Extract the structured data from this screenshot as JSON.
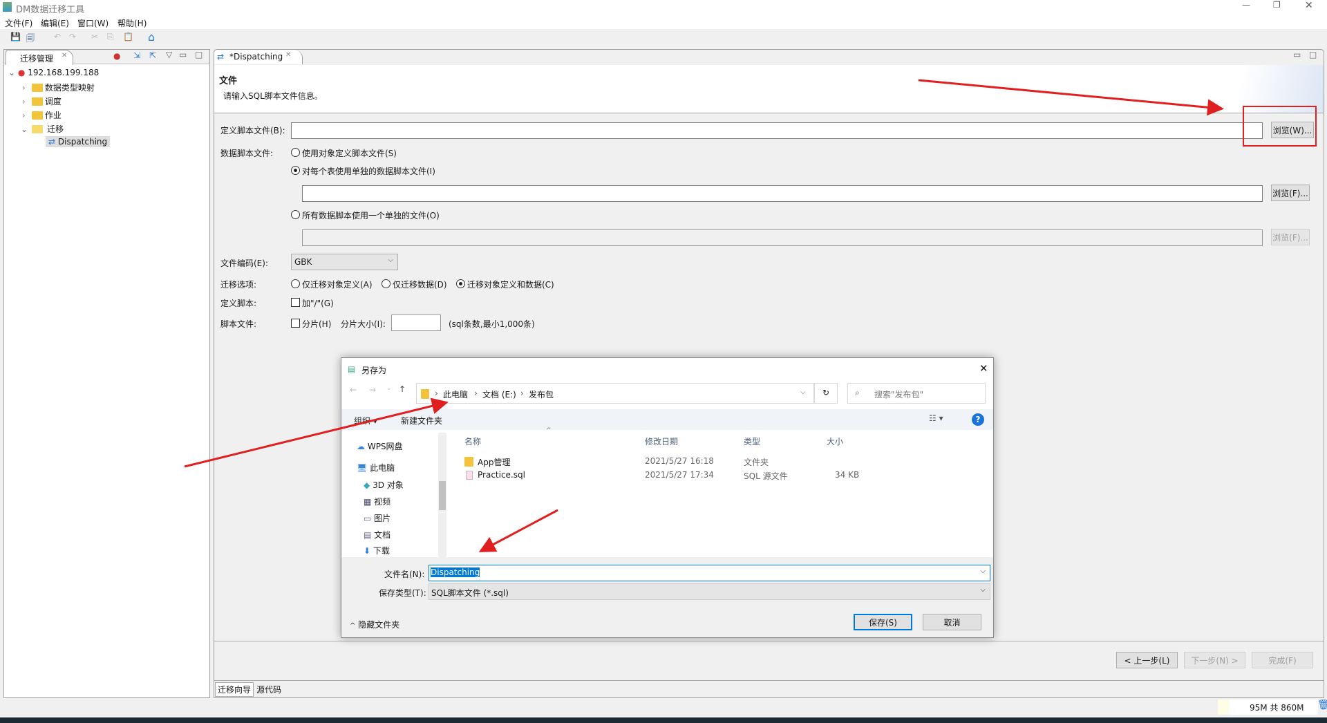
{
  "app": {
    "title": "DM数据迁移工具"
  },
  "menu": [
    "文件(F)",
    "编辑(E)",
    "窗口(W)",
    "帮助(H)"
  ],
  "left_panel": {
    "tab": "迁移管理",
    "tree": [
      {
        "label": "192.168.199.188",
        "level": 0,
        "expanded": true
      },
      {
        "label": "数据类型映射",
        "level": 1
      },
      {
        "label": "调度",
        "level": 1
      },
      {
        "label": "作业",
        "level": 1
      },
      {
        "label": "迁移",
        "level": 1,
        "expanded": true
      },
      {
        "label": "Dispatching",
        "level": 2,
        "selected": true
      }
    ]
  },
  "editor": {
    "tab": "*Dispatching",
    "section_title": "文件",
    "section_desc": "请输入SQL脚本文件信息。",
    "def_script_label": "定义脚本文件(B):",
    "def_script_value": "",
    "browse_w": "浏览(W)...",
    "data_script_label": "数据脚本文件:",
    "radio_use_def": "使用对象定义脚本文件(S)",
    "radio_per_table": "对每个表使用单独的数据脚本文件(I)",
    "radio_single": "所有数据脚本使用一个单独的文件(O)",
    "browse_f": "浏览(F)...",
    "encoding_label": "文件编码(E):",
    "encoding_value": "GBK",
    "options_label": "迁移选项:",
    "opt_def": "仅迁移对象定义(A)",
    "opt_data": "仅迁移数据(D)",
    "opt_both": "迁移对象定义和数据(C)",
    "defscript_label": "定义脚本:",
    "add_slash": "加\"/\"(G)",
    "scriptfile_label": "脚本文件:",
    "split": "分片(H)",
    "split_size_label": "分片大小(I):",
    "split_size_value": "",
    "split_hint": "(sql条数,最小1,000条)",
    "prev": "< 上一步(L)",
    "next": "下一步(N) >",
    "finish": "完成(F)",
    "bottom_tabs": [
      "迁移向导",
      "源代码"
    ]
  },
  "status": {
    "memory": "95M 共 860M"
  },
  "dialog": {
    "title": "另存为",
    "path": [
      "此电脑",
      "文档 (E:)",
      "发布包"
    ],
    "search_placeholder": "搜索\"发布包\"",
    "organize": "组织 ▾",
    "new_folder": "新建文件夹",
    "nav": [
      "WPS网盘",
      "此电脑",
      "3D 对象",
      "视频",
      "图片",
      "文档",
      "下载"
    ],
    "columns": [
      "名称",
      "修改日期",
      "类型",
      "大小"
    ],
    "files": [
      {
        "name": "App管理",
        "date": "2021/5/27 16:18",
        "type": "文件夹",
        "size": ""
      },
      {
        "name": "Practice.sql",
        "date": "2021/5/27 17:34",
        "type": "SQL 源文件",
        "size": "34 KB"
      }
    ],
    "filename_label": "文件名(N):",
    "filename_value": "Dispatching",
    "filetype_label": "保存类型(T):",
    "filetype_value": "SQL脚本文件 (*.sql)",
    "hide_folders": "隐藏文件夹",
    "save": "保存(S)",
    "cancel": "取消"
  },
  "colors": {
    "annotation": "#e02020",
    "accent": "#0078d7"
  }
}
